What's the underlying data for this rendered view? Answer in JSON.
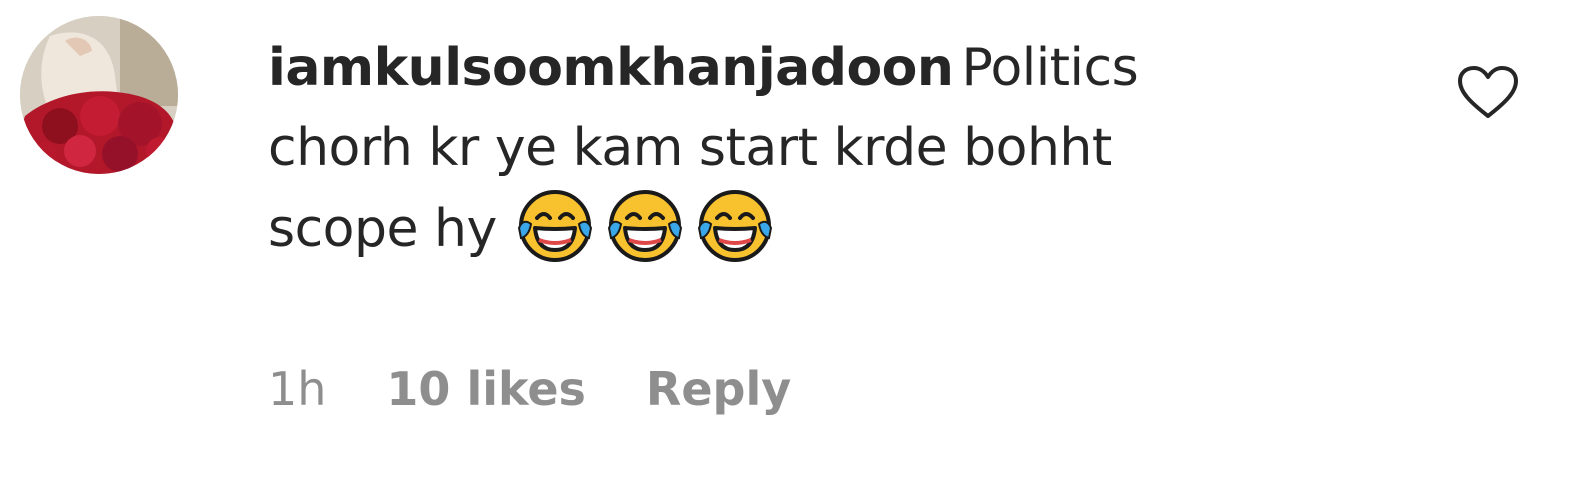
{
  "comment": {
    "username": "iamkulsoomkhanjadoon",
    "text": "Politics chorh kr ye kam start krde bohht scope hy",
    "emojis": [
      "face-with-tears-of-joy",
      "face-with-tears-of-joy",
      "face-with-tears-of-joy"
    ],
    "time": "1h",
    "likes": "10 likes",
    "reply_label": "Reply",
    "like_icon": "heart-outline-icon",
    "colors": {
      "text": "#262626",
      "secondary": "#8e8e8e",
      "background": "#ffffff"
    }
  }
}
